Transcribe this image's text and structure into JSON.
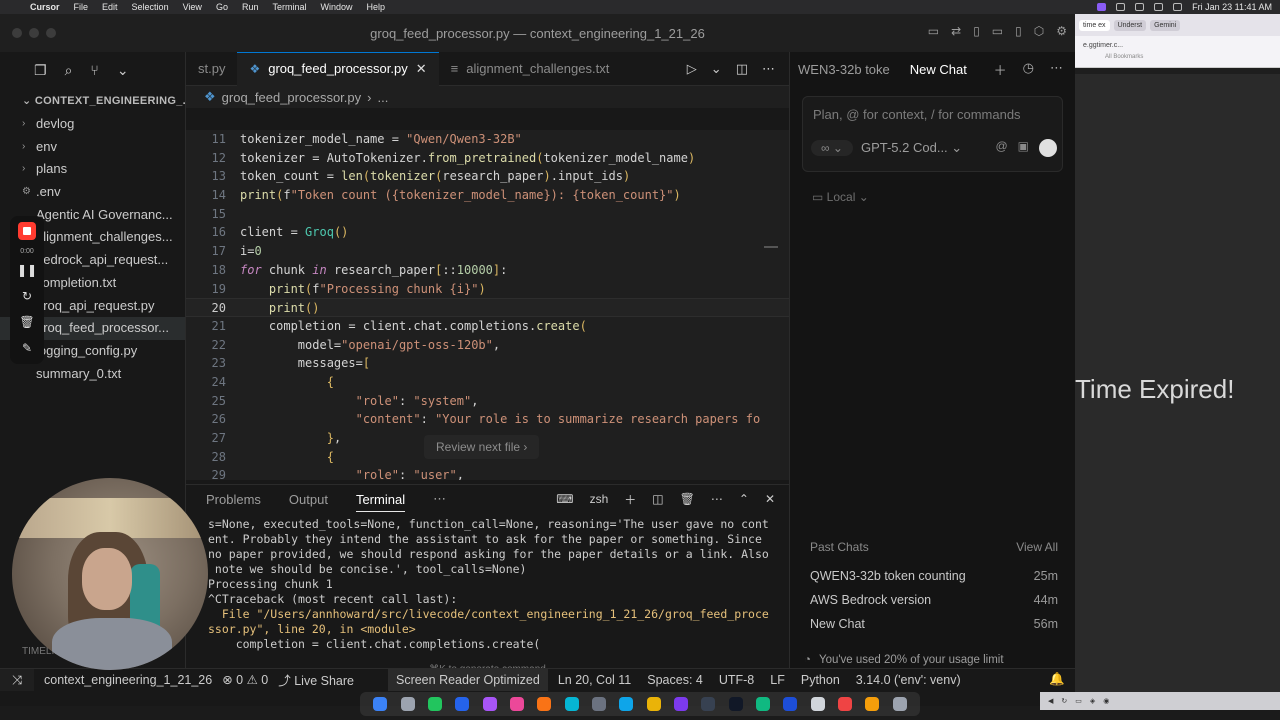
{
  "menubar": {
    "app": "Cursor",
    "items": [
      "File",
      "Edit",
      "Selection",
      "View",
      "Go",
      "Run",
      "Terminal",
      "Window",
      "Help"
    ],
    "clock": "Fri Jan 23  11:41 AM"
  },
  "window": {
    "title": "groq_feed_processor.py — context_engineering_1_21_26"
  },
  "sidebar": {
    "project": "CONTEXT_ENGINEERING_...",
    "items": [
      {
        "label": "devlog",
        "folder": true
      },
      {
        "label": "env",
        "folder": true
      },
      {
        "label": "plans",
        "folder": true
      },
      {
        "label": ".env",
        "folder": false
      },
      {
        "label": "Agentic AI Governanc...",
        "folder": false
      },
      {
        "label": "alignment_challenges...",
        "folder": false
      },
      {
        "label": "bedrock_api_request...",
        "folder": false
      },
      {
        "label": "completion.txt",
        "folder": false
      },
      {
        "label": "groq_api_request.py",
        "folder": false
      },
      {
        "label": "groq_feed_processor...",
        "folder": false
      },
      {
        "label": "logging_config.py",
        "folder": false
      },
      {
        "label": "summary_0.txt",
        "folder": false
      }
    ],
    "bottom_section": "TIMELINE"
  },
  "recorder": {
    "time": "0:00"
  },
  "tabs": [
    {
      "label": "st.py",
      "active": false
    },
    {
      "label": "groq_feed_processor.py",
      "active": true
    },
    {
      "label": "alignment_challenges.txt",
      "active": false
    }
  ],
  "breadcrumb": {
    "file": "groq_feed_processor.py",
    "more": "..."
  },
  "code": {
    "lines": [
      {
        "n": "11",
        "text": "tokenizer_model_name = \"Qwen/Qwen3-32B\""
      },
      {
        "n": "12",
        "text": "tokenizer = AutoTokenizer.from_pretrained(tokenizer_model_name)"
      },
      {
        "n": "13",
        "text": "token_count = len(tokenizer(research_paper).input_ids)"
      },
      {
        "n": "14",
        "text": "print(f\"Token count ({tokenizer_model_name}): {token_count}\")"
      },
      {
        "n": "15",
        "text": ""
      },
      {
        "n": "16",
        "text": "client = Groq()"
      },
      {
        "n": "17",
        "text": "i=0"
      },
      {
        "n": "18",
        "text": "for chunk in research_paper[::10000]:"
      },
      {
        "n": "19",
        "text": "    print(f\"Processing chunk {i}\")"
      },
      {
        "n": "20",
        "text": "    print()"
      },
      {
        "n": "21",
        "text": "    completion = client.chat.completions.create("
      },
      {
        "n": "22",
        "text": "        model=\"openai/gpt-oss-120b\","
      },
      {
        "n": "23",
        "text": "        messages=["
      },
      {
        "n": "24",
        "text": "            {"
      },
      {
        "n": "25",
        "text": "                \"role\": \"system\","
      },
      {
        "n": "26",
        "text": "                \"content\": \"Your role is to summarize research papers fo"
      },
      {
        "n": "27",
        "text": "            },"
      },
      {
        "n": "28",
        "text": "            {"
      },
      {
        "n": "29",
        "text": "                \"role\": \"user\","
      }
    ],
    "current_line": "20",
    "hint": "Review next file"
  },
  "panel": {
    "tabs": [
      "Problems",
      "Output",
      "Terminal"
    ],
    "active_tab": "Terminal",
    "shell": "zsh",
    "lines": [
      "s=None, executed_tools=None, function_call=None, reasoning='The user gave no cont",
      "ent. Probably they intend the assistant to ask for the paper or something. Since",
      "no paper provided, we should respond asking for the paper details or a link. Also",
      " note we should be concise.', tool_calls=None)",
      "Processing chunk 1",
      "^CTraceback (most recent call last):",
      "  File \"/Users/annhoward/src/livecode/context_engineering_1_21_26/groq_feed_proce",
      "ssor.py\", line 20, in <module>",
      "    completion = client.chat.completions.create("
    ],
    "hint": "⌘K to generate command"
  },
  "chat": {
    "tab_prev": "WEN3-32b toke",
    "tab_active": "New Chat",
    "placeholder": "Plan, @ for context, / for commands",
    "mode": "∞",
    "model": "GPT-5.2 Cod...",
    "local": "Local",
    "past_header": "Past Chats",
    "view_all": "View All",
    "past": [
      {
        "title": "QWEN3-32b token counting",
        "age": "25m"
      },
      {
        "title": "AWS Bedrock version",
        "age": "44m"
      },
      {
        "title": "New Chat",
        "age": "56m"
      }
    ],
    "usage": "You've used 20% of your usage limit"
  },
  "status": {
    "branch": "context_engineering_1_21_26",
    "errors": "0",
    "warnings": "0",
    "live_share": "Live Share",
    "screen_reader": "Screen Reader Optimized",
    "position": "Ln 20, Col 11",
    "spaces": "Spaces: 4",
    "encoding": "UTF-8",
    "eol": "LF",
    "language": "Python",
    "interpreter": "3.14.0 ('env': venv)"
  },
  "browser": {
    "tabs": [
      "time ex",
      "Underst",
      "Gemini"
    ],
    "url": "e.ggtimer.c...",
    "bookmarks": "All Bookmarks",
    "message": "Time Expired!"
  }
}
